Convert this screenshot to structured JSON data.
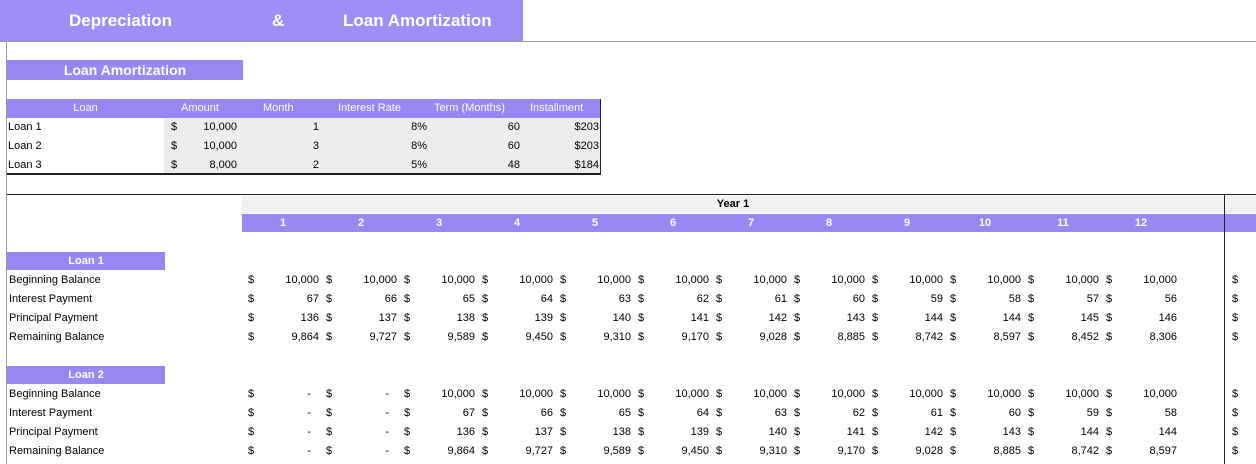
{
  "header": {
    "left": "Depreciation",
    "amp": "&",
    "right": "Loan Amortization"
  },
  "section_title": "Loan Amortization",
  "summary": {
    "columns": [
      "Loan",
      "Amount",
      "Month",
      "Interest Rate",
      "Term (Months)",
      "Installment"
    ],
    "rows": [
      {
        "name": "Loan 1",
        "currency": "$",
        "amount": "10,000",
        "month": "1",
        "rate": "8%",
        "term": "60",
        "installment": "$203"
      },
      {
        "name": "Loan 2",
        "currency": "$",
        "amount": "10,000",
        "month": "3",
        "rate": "8%",
        "term": "60",
        "installment": "$203"
      },
      {
        "name": "Loan 3",
        "currency": "$",
        "amount": "8,000",
        "month": "2",
        "rate": "5%",
        "term": "48",
        "installment": "$184"
      }
    ]
  },
  "schedule": {
    "year_label": "Year 1",
    "months": [
      "1",
      "2",
      "3",
      "4",
      "5",
      "6",
      "7",
      "8",
      "9",
      "10",
      "11",
      "12"
    ],
    "currency": "$",
    "loans": [
      {
        "label": "Loan 1",
        "rows": [
          {
            "label": "Beginning Balance",
            "values": [
              "10,000",
              "10,000",
              "10,000",
              "10,000",
              "10,000",
              "10,000",
              "10,000",
              "10,000",
              "10,000",
              "10,000",
              "10,000",
              "10,000"
            ]
          },
          {
            "label": "Interest Payment",
            "values": [
              "67",
              "66",
              "65",
              "64",
              "63",
              "62",
              "61",
              "60",
              "59",
              "58",
              "57",
              "56"
            ]
          },
          {
            "label": "Principal Payment",
            "values": [
              "136",
              "137",
              "138",
              "139",
              "140",
              "141",
              "142",
              "143",
              "144",
              "144",
              "145",
              "146"
            ]
          },
          {
            "label": "Remaining Balance",
            "values": [
              "9,864",
              "9,727",
              "9,589",
              "9,450",
              "9,310",
              "9,170",
              "9,028",
              "8,885",
              "8,742",
              "8,597",
              "8,452",
              "8,306"
            ]
          }
        ]
      },
      {
        "label": "Loan 2",
        "rows": [
          {
            "label": "Beginning Balance",
            "values": [
              "-",
              "-",
              "10,000",
              "10,000",
              "10,000",
              "10,000",
              "10,000",
              "10,000",
              "10,000",
              "10,000",
              "10,000",
              "10,000"
            ]
          },
          {
            "label": "Interest Payment",
            "values": [
              "-",
              "-",
              "67",
              "66",
              "65",
              "64",
              "63",
              "62",
              "61",
              "60",
              "59",
              "58"
            ]
          },
          {
            "label": "Principal Payment",
            "values": [
              "-",
              "-",
              "136",
              "137",
              "138",
              "139",
              "140",
              "141",
              "142",
              "143",
              "144",
              "144"
            ]
          },
          {
            "label": "Remaining Balance",
            "values": [
              "-",
              "-",
              "9,864",
              "9,727",
              "9,589",
              "9,450",
              "9,310",
              "9,170",
              "9,028",
              "8,885",
              "8,742",
              "8,597"
            ]
          }
        ]
      }
    ]
  }
}
